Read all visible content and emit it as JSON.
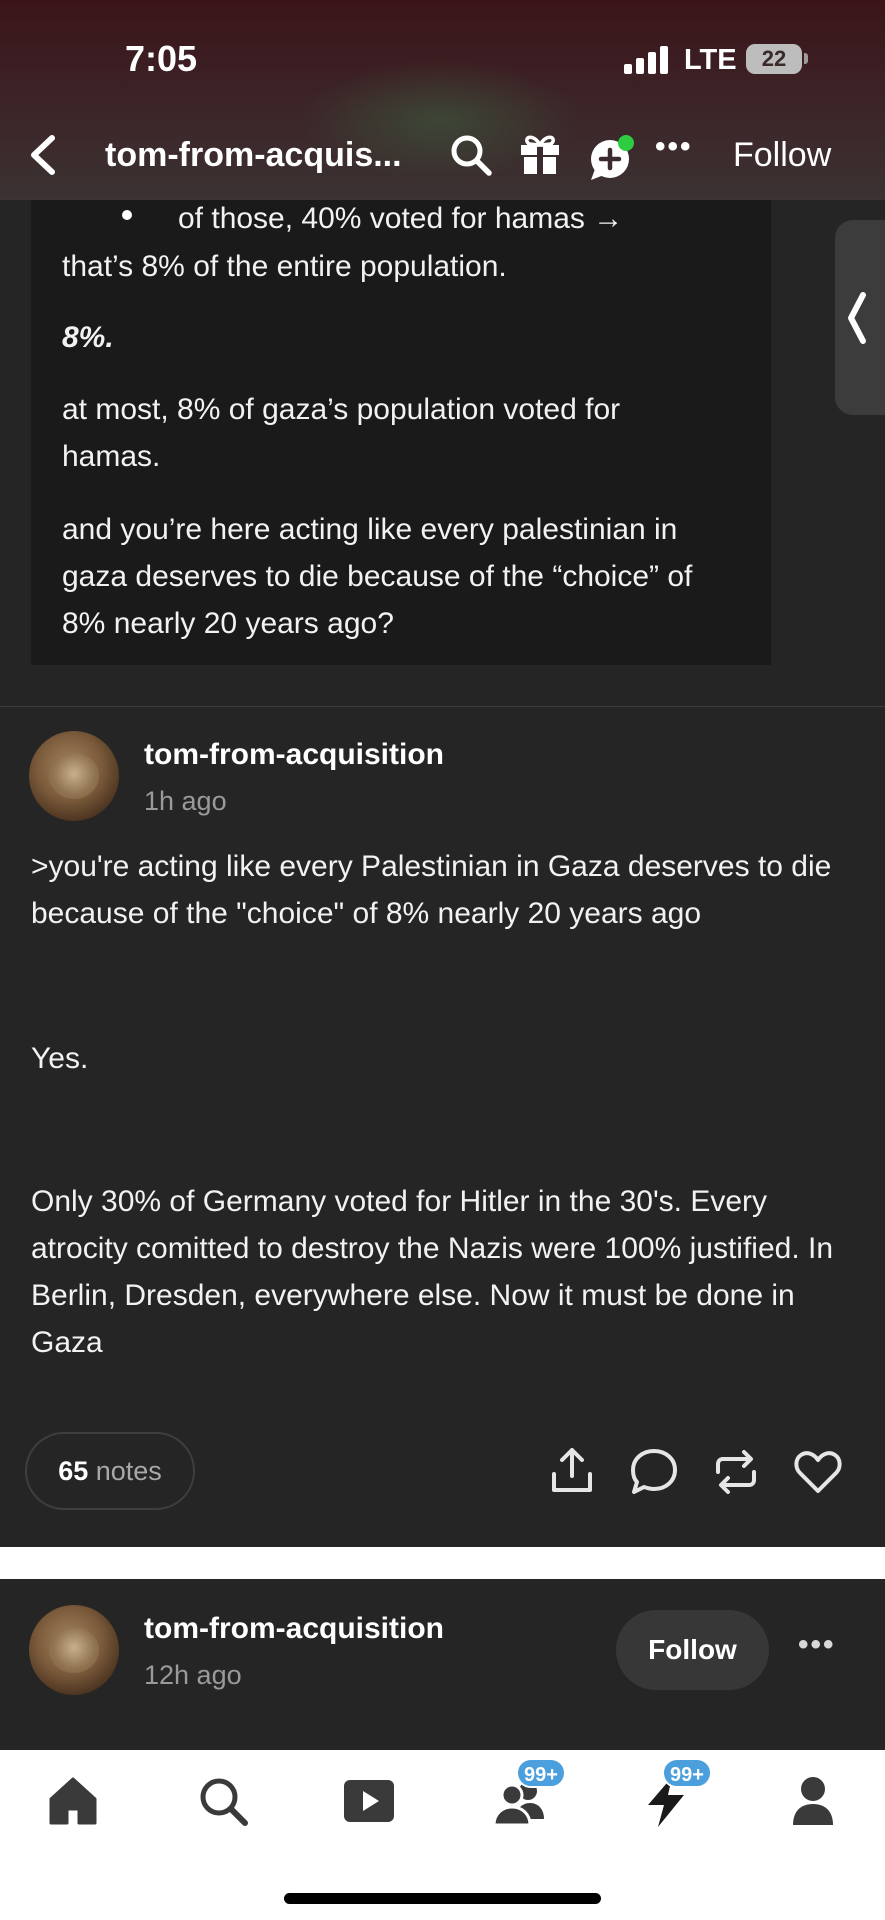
{
  "status_bar": {
    "time": "7:05",
    "network": "LTE",
    "battery": "22"
  },
  "header": {
    "blog_title": "tom-from-acquis...",
    "follow_label": "Follow",
    "icons": [
      "back-arrow-icon",
      "search-icon",
      "gift-icon",
      "chat-plus-icon",
      "more-icon"
    ],
    "accent": "#2ecc40"
  },
  "previous_post": {
    "bullet_text": "of those, 40% voted for hamas →",
    "line1": "that’s 8% of the entire population.",
    "emphasis": "8%.",
    "para2": "at most, 8% of gaza’s population voted for hamas.",
    "para3": "and you’re here acting like every palestinian in gaza deserves to die because of the “choice” of 8% nearly 20 years ago?"
  },
  "reply": {
    "username": "tom-from-acquisition",
    "time_ago": "1h ago",
    "quote": ">you're acting like every Palestinian in Gaza deserves to die because of the \"choice\" of 8% nearly 20 years ago",
    "answer": "Yes.",
    "paragraph": "Only 30% of Germany voted for Hitler in the 30's. Every atrocity comitted to destroy the Nazis were 100% justified. In Berlin, Dresden, everywhere else. Now it must be done in Gaza",
    "notes_count": "65",
    "notes_label": "notes",
    "actions": [
      "share-icon",
      "comment-icon",
      "reblog-icon",
      "like-icon"
    ]
  },
  "next_post": {
    "username": "tom-from-acquisition",
    "time_ago": "12h ago",
    "follow_label": "Follow"
  },
  "bottom_nav": {
    "items": [
      "home-icon",
      "search-icon",
      "video-icon",
      "people-icon",
      "activity-icon",
      "account-icon"
    ],
    "people_badge": "99+",
    "activity_badge": "99+",
    "badge_color": "#4b9fdc"
  }
}
